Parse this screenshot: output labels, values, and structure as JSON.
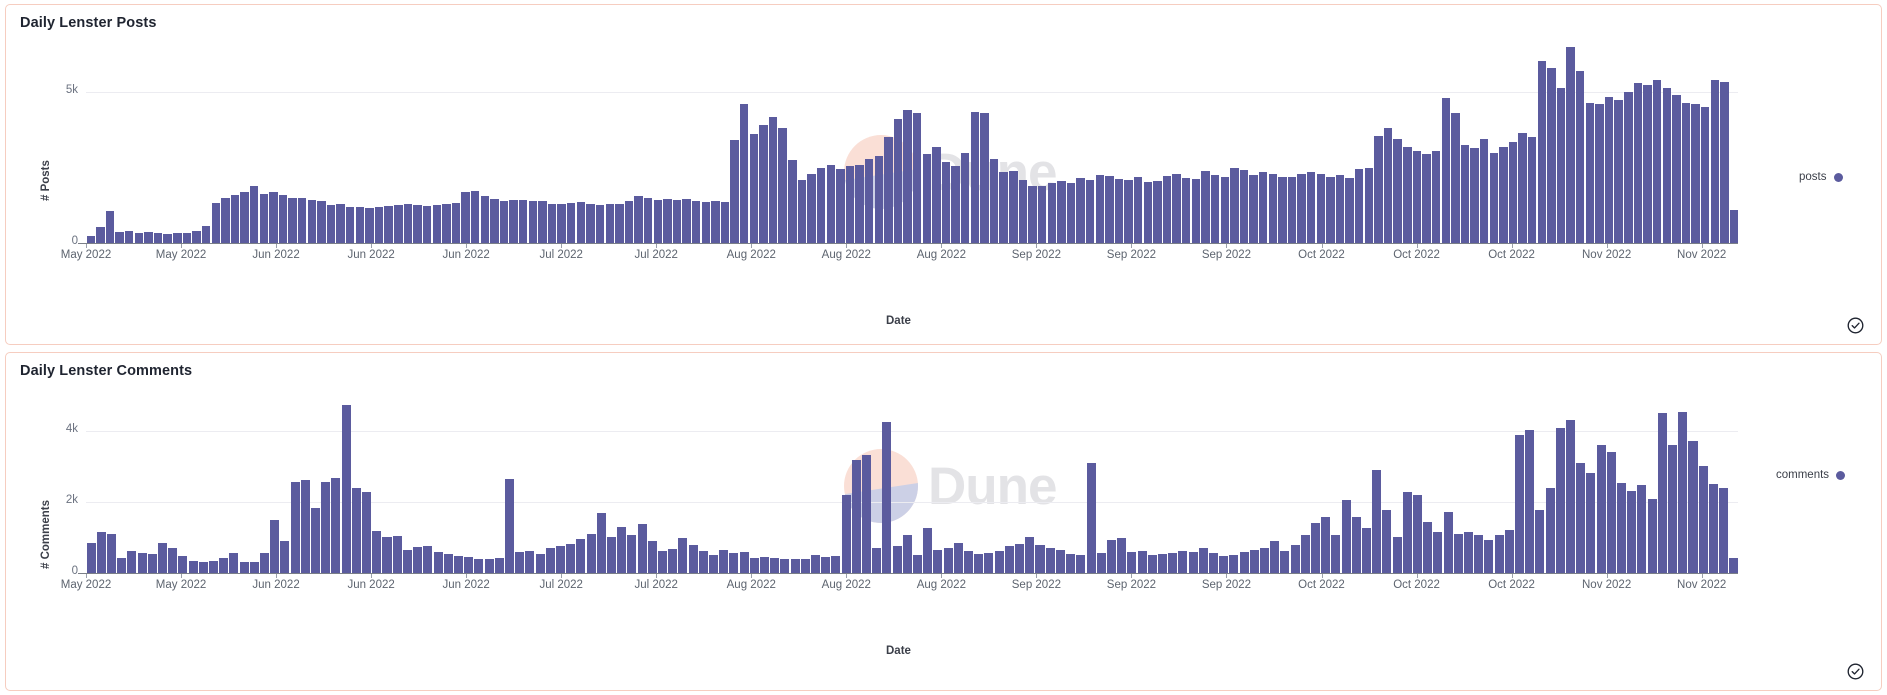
{
  "charts": [
    {
      "panel_id": "daily-lenster-posts",
      "title": "Daily Lenster Posts",
      "legend_label": "posts",
      "legend_color": "#5b5b9e",
      "check_icon": "check-circle-icon",
      "watermark_text": "Dune",
      "chart_data": {
        "type": "bar",
        "title": "Daily Lenster Posts",
        "xlabel": "Date",
        "ylabel": "# Posts",
        "series_name": "posts",
        "color": "#5b5b9e",
        "grid": true,
        "legend_position": "right",
        "ylim": [
          0,
          6500
        ],
        "yticks": [
          0,
          5000
        ],
        "ytick_labels": [
          "0",
          "5k"
        ],
        "xtick_labels": [
          "May 2022",
          "May 2022",
          "Jun 2022",
          "Jun 2022",
          "Jun 2022",
          "Jul 2022",
          "Jul 2022",
          "Aug 2022",
          "Aug 2022",
          "Aug 2022",
          "Sep 2022",
          "Sep 2022",
          "Sep 2022",
          "Oct 2022",
          "Oct 2022",
          "Oct 2022",
          "Nov 2022",
          "Nov 2022"
        ],
        "values": [
          220,
          520,
          1050,
          380,
          400,
          330,
          360,
          330,
          300,
          320,
          340,
          400,
          560,
          1320,
          1500,
          1600,
          1700,
          1880,
          1620,
          1700,
          1600,
          1500,
          1480,
          1420,
          1380,
          1260,
          1300,
          1180,
          1200,
          1160,
          1200,
          1230,
          1260,
          1300,
          1250,
          1240,
          1270,
          1290,
          1320,
          1700,
          1720,
          1560,
          1460,
          1400,
          1410,
          1440,
          1380,
          1400,
          1280,
          1300,
          1340,
          1360,
          1300,
          1260,
          1280,
          1300,
          1390,
          1560,
          1500,
          1440,
          1460,
          1420,
          1450,
          1400,
          1350,
          1380,
          1350,
          3400,
          4620,
          3600,
          3900,
          4180,
          3800,
          2750,
          2100,
          2280,
          2500,
          2600,
          2450,
          2560,
          2600,
          2780,
          2900,
          3500,
          4100,
          4400,
          4300,
          2950,
          3180,
          2700,
          2550,
          2980,
          4350,
          4300,
          2800,
          2350,
          2400,
          2080,
          1880,
          1900,
          2000,
          2050,
          1980,
          2150,
          2100,
          2250,
          2220,
          2120,
          2100,
          2180,
          2040,
          2050,
          2230,
          2300,
          2150,
          2120,
          2400,
          2260,
          2180,
          2480,
          2420,
          2250,
          2360,
          2300,
          2200,
          2180,
          2300,
          2340,
          2280,
          2200,
          2250,
          2150,
          2450,
          2500,
          3550,
          3800,
          3450,
          3200,
          3050,
          2950,
          3050,
          4800,
          4300,
          3250,
          3150,
          3450,
          3000,
          3200,
          3350,
          3650,
          3500,
          6050,
          5800,
          5150,
          6500,
          5700,
          4650,
          4600,
          4850,
          4750,
          5000,
          5300,
          5250,
          5400,
          5150,
          4900,
          4650,
          4600,
          4500,
          5400,
          5350,
          1100
        ]
      }
    },
    {
      "panel_id": "daily-lenster-comments",
      "title": "Daily Lenster Comments",
      "legend_label": "comments",
      "legend_color": "#5b5b9e",
      "check_icon": "check-circle-icon",
      "watermark_text": "Dune",
      "chart_data": {
        "type": "bar",
        "title": "Daily Lenster Comments",
        "xlabel": "Date",
        "ylabel": "# Comments",
        "series_name": "comments",
        "color": "#5b5b9e",
        "grid": true,
        "legend_position": "right",
        "ylim": [
          0,
          5000
        ],
        "yticks": [
          0,
          2000,
          4000
        ],
        "ytick_labels": [
          "0",
          "2k",
          "4k"
        ],
        "xtick_labels": [
          "May 2022",
          "May 2022",
          "Jun 2022",
          "Jun 2022",
          "Jun 2022",
          "Jul 2022",
          "Jul 2022",
          "Aug 2022",
          "Aug 2022",
          "Aug 2022",
          "Sep 2022",
          "Sep 2022",
          "Sep 2022",
          "Oct 2022",
          "Oct 2022",
          "Oct 2022",
          "Nov 2022",
          "Nov 2022"
        ],
        "values": [
          850,
          1150,
          1100,
          430,
          620,
          560,
          540,
          840,
          700,
          480,
          340,
          300,
          330,
          420,
          560,
          300,
          320,
          560,
          1500,
          900,
          2550,
          2600,
          1820,
          2560,
          2680,
          4730,
          2400,
          2280,
          1180,
          1000,
          1050,
          640,
          720,
          760,
          600,
          540,
          480,
          460,
          380,
          400,
          430,
          2630,
          580,
          620,
          540,
          700,
          760,
          820,
          960,
          1100,
          1680,
          1000,
          1300,
          1060,
          1380,
          900,
          620,
          680,
          980,
          800,
          620,
          520,
          640,
          560,
          600,
          420,
          440,
          420,
          380,
          400,
          380,
          520,
          460,
          480,
          2180,
          3180,
          3320,
          700,
          4250,
          760,
          1080,
          500,
          1260,
          640,
          700,
          840,
          620,
          540,
          560,
          620,
          760,
          820,
          1020,
          780,
          700,
          640,
          540,
          500,
          3100,
          560,
          940,
          980,
          600,
          620,
          520,
          540,
          560,
          620,
          580,
          700,
          560,
          480,
          520,
          600,
          640,
          700,
          900,
          620,
          800,
          1060,
          1400,
          1560,
          1080,
          2060,
          1560,
          1260,
          2900,
          1760,
          1020,
          2280,
          2180,
          1420,
          1160,
          1700,
          1100,
          1140,
          1080,
          940,
          1080,
          1200,
          3880,
          4020,
          1760,
          2400,
          4080,
          4300,
          3080,
          2800,
          3600,
          3400,
          2520,
          2300,
          2480,
          2080,
          4500,
          3600,
          4520,
          3700,
          3000,
          2500,
          2400,
          420
        ]
      }
    }
  ]
}
